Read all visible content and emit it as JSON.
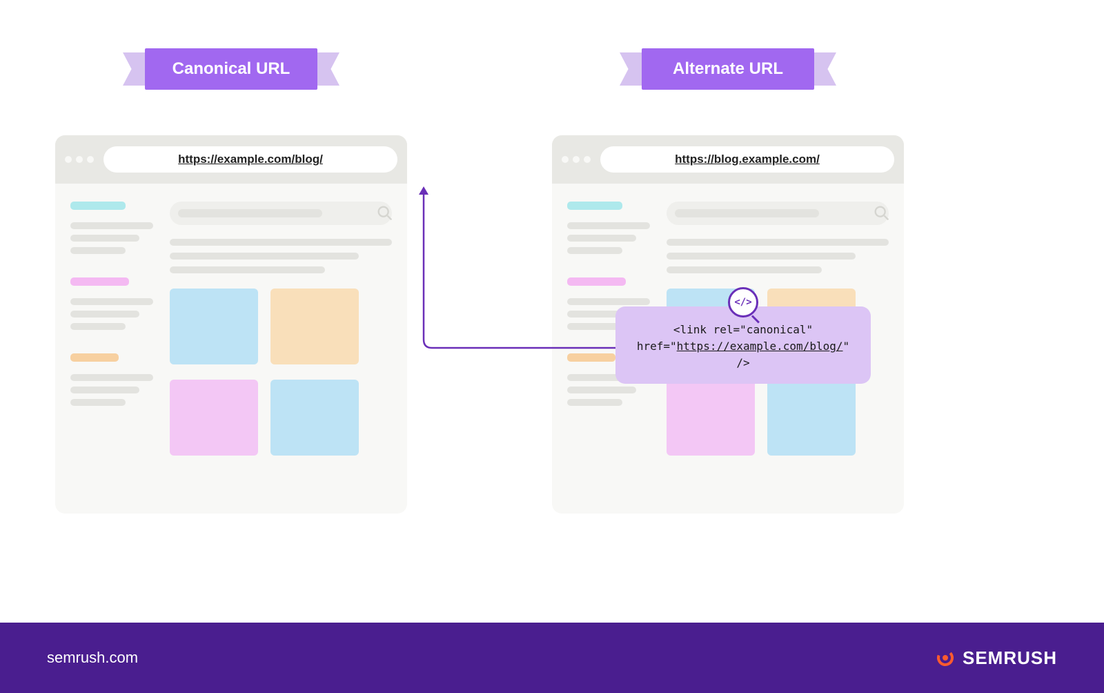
{
  "banners": {
    "canonical": "Canonical URL",
    "alternate": "Alternate URL"
  },
  "urls": {
    "canonical": "https://example.com/blog/",
    "alternate": "https://blog.example.com/"
  },
  "code_tooltip": {
    "line1": "<link rel=\"canonical\"",
    "line2_prefix": "href=\"",
    "line2_url": "https://example.com/blog/",
    "line2_suffix": "\" />",
    "icon_label": "</>"
  },
  "footer": {
    "url": "semrush.com",
    "brand": "SEMRUSH"
  },
  "colors": {
    "banner": "#a168f0",
    "ribbon": "#d6c3f0",
    "tooltip": "#dcc5f5",
    "footer": "#4a1e8f",
    "accent_dark": "#6a2fb8"
  }
}
